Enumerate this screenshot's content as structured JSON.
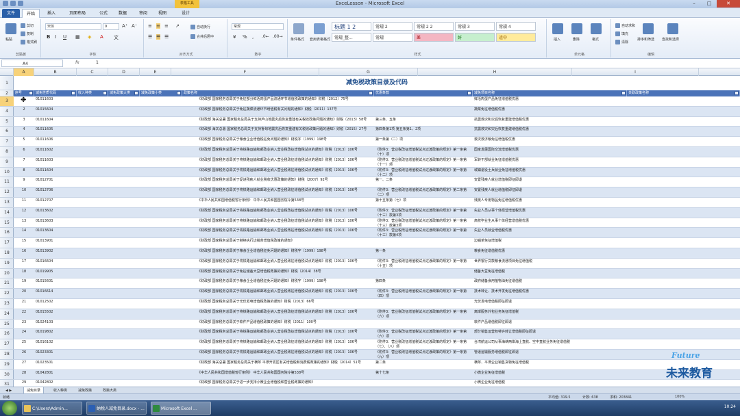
{
  "window": {
    "title": "ExceLesson - Microsoft Excel",
    "context_tab": "表格工具"
  },
  "tabs": [
    "文件",
    "开始",
    "插入",
    "页面布局",
    "公式",
    "数据",
    "审阅",
    "视图",
    "设计"
  ],
  "ribbon": {
    "clipboard": {
      "label": "剪贴板",
      "paste": "粘贴",
      "cut": "剪切",
      "copy": "复制",
      "format_painter": "格式刷"
    },
    "font": {
      "label": "字体",
      "name": "宋体",
      "size": "9"
    },
    "align": {
      "label": "对齐方式",
      "wrap": "自动换行",
      "merge": "合并后居中"
    },
    "number": {
      "label": "数字",
      "format": "常规"
    },
    "styles": {
      "label": "样式",
      "cond": "条件格式",
      "table": "套用表格格式",
      "cells": [
        {
          "text": "标题 1 2",
          "bg": "#ffffff",
          "fg": "#1f3f7a"
        },
        {
          "text": "常规 2",
          "bg": "#ffffff",
          "fg": "#333"
        },
        {
          "text": "常规 2 2",
          "bg": "#ffffff",
          "fg": "#333"
        },
        {
          "text": "常规 3",
          "bg": "#ffffff",
          "fg": "#333"
        },
        {
          "text": "常规 4",
          "bg": "#ffffff",
          "fg": "#333"
        },
        {
          "text": "常规_整...",
          "bg": "#ffffff",
          "fg": "#333"
        },
        {
          "text": "常规",
          "bg": "#ffffff",
          "fg": "#333"
        },
        {
          "text": "差",
          "bg": "#f4b6c2",
          "fg": "#9c0006"
        },
        {
          "text": "好",
          "bg": "#c6efce",
          "fg": "#006100"
        },
        {
          "text": "适中",
          "bg": "#ffeb9c",
          "fg": "#9c6500"
        }
      ]
    },
    "cells": {
      "label": "单元格",
      "insert": "插入",
      "delete": "删除",
      "format": "格式"
    },
    "editing": {
      "label": "编辑",
      "autosum": "自动求和",
      "fill": "填充",
      "clear": "清除",
      "sort": "排序和筛选",
      "find": "查找和选择"
    }
  },
  "formula": {
    "cell_ref": "A4",
    "value": "1"
  },
  "columns": [
    "A",
    "B",
    "C",
    "D",
    "E",
    "F",
    "G",
    "H",
    "I"
  ],
  "sheet": {
    "title": "减免税政策目录及代码",
    "headers": [
      "序号",
      "减免性质代码",
      "收入种类",
      "减免政策大类",
      "减免政策小类",
      "政策名称",
      "优惠条款",
      "减免项目名称",
      "关联政策名称"
    ],
    "rows": [
      {
        "n": "1",
        "code": "01011603",
        "policy": "《财政部 国家税务总局关于免征部分鲜活肉蛋产品流通环节增值税政策的通知》财税〔2012〕75号",
        "clause": "",
        "item": "鲜活肉蛋产品免征增值税优惠"
      },
      {
        "n": "2",
        "code": "01015604",
        "policy": "《财政部 国家税务总局关于免征蔬菜流通环节增值税有关问题的通知》财税〔2011〕137号",
        "clause": "",
        "item": "蔬菜免征增值税优惠"
      },
      {
        "n": "3",
        "code": "01011604",
        "policy": "《财政部 海关总署 国家税务总局关于支持芦山地震灾后恢复重建有关税收政策问题的通知》财税〔2013〕58号",
        "clause": "第三条、五条",
        "item": "抗震救灾和灾后恢复重建增值税优惠"
      },
      {
        "n": "4",
        "code": "01011605",
        "policy": "《财政部 海关总署 国家税务总局关于支持鲁甸地震灾后恢复重建有关税收政策问题的通知》财税〔2015〕27号",
        "clause": "第四条第1项 第五条第1、2项",
        "item": "抗震救灾和灾后恢复重建增值税优惠"
      },
      {
        "n": "5",
        "code": "01011606",
        "policy": "《财政部 国家税务总局关于粮食企业增值税征免问题的通知》财税字〔1999〕198号",
        "clause": "第一条第（二）项",
        "item": "救灾救济粮免征增值税优惠"
      },
      {
        "n": "6",
        "code": "01011602",
        "policy": "《财政部 国家税务总局关于将铁路运输和邮政业纳入营业税改征增值税试点的通知》财税〔2013〕106号",
        "clause": "《附件3：营业税改征增值税试点过渡政策的规定》第一条第（十）项",
        "item": "国家发展国际交流增值税优惠"
      },
      {
        "n": "7",
        "code": "01011603",
        "policy": "《财政部 国家税务总局关于将铁路运输和邮政业纳入营业税改征增值税试点的通知》财税〔2013〕106号",
        "clause": "《附件3：营业税改征增值税试点过渡政策的规定》第一条第（十一）项",
        "item": "军转干部就业免征增值税优惠"
      },
      {
        "n": "8",
        "code": "01011604",
        "policy": "《财政部 国家税务总局关于将铁路运输和邮政业纳入营业税改征增值税试点的通知》财税〔2013〕106号",
        "clause": "《附件3：营业税改征增值税试点过渡政策的规定》第一条第（十二）项",
        "item": "城镇退役士兵就业免征增值税优惠"
      },
      {
        "n": "9",
        "code": "01012701",
        "policy": "《财政部 国家税务总局关于促进残疾人就业税收优惠政策的通知》财税〔2007〕92号",
        "clause": "第一、二条",
        "item": "安置残疾人就业增值税即征即退"
      },
      {
        "n": "10",
        "code": "01012706",
        "policy": "《财政部 国家税务总局关于将铁路运输和邮政业纳入营业税改征增值税试点的通知》财税〔2013〕106号",
        "clause": "《附件3：营业税改征增值税试点过渡政策的规定》第二条第（二）项",
        "item": "安置残疾人就业增值税即征即退"
      },
      {
        "n": "11",
        "code": "01012707",
        "policy": "《中华人民共和国增值税暂行条例》 中华人民共和国国务院令第538号",
        "clause": "第十五条第（七）项",
        "item": "残疾人专用物品免征增值税优惠"
      },
      {
        "n": "12",
        "code": "01013602",
        "policy": "《财政部 国家税务总局关于将铁路运输和邮政业纳入营业税改征增值税试点的通知》财税〔2013〕106号",
        "clause": "《附件3：营业税改征增值税试点过渡政策的规定》第一条第（十三）款第3项",
        "item": "失业人员从事个体经营增值税优惠"
      },
      {
        "n": "13",
        "code": "01013603",
        "policy": "《财政部 国家税务总局关于将铁路运输和邮政业纳入营业税改征增值税试点的通知》财税〔2013〕106号",
        "clause": "《附件3：营业税改征增值税试点过渡政策的规定》第一条第（十三）款第3项",
        "item": "高校毕业生从事个体经营增值税优惠"
      },
      {
        "n": "14",
        "code": "01013604",
        "policy": "《财政部 国家税务总局关于将铁路运输和邮政业纳入营业税改征增值税试点的通知》财税〔2013〕106号",
        "clause": "《附件3：营业税改征增值税试点过渡政策的规定》第一条第（十三）款第4项",
        "item": "失业人员就业增值税优惠"
      },
      {
        "n": "15",
        "code": "01013901",
        "policy": "《财政部 国家税务总局关于继续执行边销茶增值税政策的通知》",
        "clause": "",
        "item": "边销茶免征增值税"
      },
      {
        "n": "16",
        "code": "01013902",
        "policy": "《财政部 国家税务总局关于粮食企业增值税征免问题的通知》财税字〔1999〕198号",
        "clause": "第一条",
        "item": "粮食免征增值税优惠"
      },
      {
        "n": "17",
        "code": "01016604",
        "policy": "《财政部 国家税务总局关于将铁路运输和邮政业纳入营业税改征增值税试点的通知》财税〔2013〕106号",
        "clause": "《附件3：营业税改征增值税试点过渡政策的规定》第一条第（十五）项",
        "item": "世界银行贷款粮食流通项目免征增值税"
      },
      {
        "n": "18",
        "code": "01019905",
        "policy": "《财政部 国家税务总局关于免征储备大豆增值税政策的通知》财税〔2014〕38号",
        "clause": "",
        "item": "储备大豆免征增值税"
      },
      {
        "n": "19",
        "code": "01015601",
        "policy": "《财政部 国家税务总局关于粮食企业增值税征免问题的通知》财税字〔1999〕198号",
        "clause": "第四条",
        "item": "政府储备食用植物油免征增值税"
      },
      {
        "n": "20",
        "code": "01016614",
        "policy": "《财政部 国家税务总局关于将铁路运输和邮政业纳入营业税改征增值税试点的通知》财税〔2013〕106号",
        "clause": "《附件3：营业税改征增值税试点过渡政策的规定》第一条第（四）项",
        "item": "技术转让、技术开发免征增值税优惠"
      },
      {
        "n": "21",
        "code": "01012502",
        "policy": "《财政部 国家税务总局关于光伏发电增值税政策的通知》财税〔2013〕66号",
        "clause": "",
        "item": "光伏发电增值税即征即退"
      },
      {
        "n": "22",
        "code": "01015502",
        "policy": "《财政部 国家税务总局关于将铁路运输和邮政业纳入营业税改征增值税试点的通知》财税〔2013〕106号",
        "clause": "《附件3：营业税改征增值税试点过渡政策的规定》第一条第（六）项",
        "item": "离岸服务外包业务免征增值税"
      },
      {
        "n": "23",
        "code": "01024103",
        "policy": "《财政部 国家税务总局关于软件产品增值税政策的通知》财税〔2011〕100号",
        "clause": "",
        "item": "软件产品增值税即征即退"
      },
      {
        "n": "24",
        "code": "01019802",
        "policy": "《财政部 国家税务总局关于将铁路运输和邮政业纳入营业税改征增值税试点的通知》财税〔2013〕106号",
        "clause": "《附件3：营业税改征增值税试点过渡政策的规定》第一条第（六）项",
        "item": "部分销售运营权特许转让增值税即征即退"
      },
      {
        "n": "25",
        "code": "01016102",
        "policy": "《财政部 国家税务总局关于将铁路运输和邮政业纳入营业税改征增值税试点的通知》财税〔2013〕106号",
        "clause": "《附件3：营业税改征增值税试点过渡政策的规定》第一条第（七）、（八）项",
        "item": "台湾航运公司从事海峡两岸海上直航、空中直航业务免征增值税"
      },
      {
        "n": "26",
        "code": "01023301",
        "policy": "《财政部 国家税务总局关于将铁路运输和邮政业纳入营业税改征增值税试点的通知》财税〔2013〕106号",
        "clause": "《附件3：营业税改征增值税试点过渡政策的规定》第一条第（九）项",
        "item": "管道运输服务增值税即征即退"
      },
      {
        "n": "27",
        "code": "01023501",
        "policy": "《财政部 海关总署 国家税务总局关于横琴 平潭开发区有关增值税和消费税政策的通知》财税〔2014〕51号",
        "clause": "第二条",
        "item": "横琴、平潭企业销售货物免征增值税"
      },
      {
        "n": "28",
        "code": "01042801",
        "policy": "《中华人民共和国增值税暂行条例》 中华人民共和国国务院令第538号",
        "clause": "第十七条",
        "item": "小微企业免征增值税"
      },
      {
        "n": "29",
        "code": "01042802",
        "policy": "《财政部 国家税务总局关于进一步支持小微企业增值税和营业税政策的通知》",
        "clause": "",
        "item": "小微企业免征增值税"
      }
    ]
  },
  "sheet_tabs": [
    "减免目录",
    "收入种类",
    "减免政策",
    "政策大类"
  ],
  "status": {
    "ready": "就绪",
    "avg": "平均值: 319.5",
    "count": "计数: 638",
    "sum": "求和: 203841",
    "zoom": "100%"
  },
  "taskbar": {
    "items": [
      "C:\\Users\\Admin...",
      "纳税人减免目录.docx - ...",
      "Microsoft Excel ..."
    ],
    "time": "10:24"
  },
  "watermark": {
    "line1": "Future",
    "line2": "未来教育"
  }
}
